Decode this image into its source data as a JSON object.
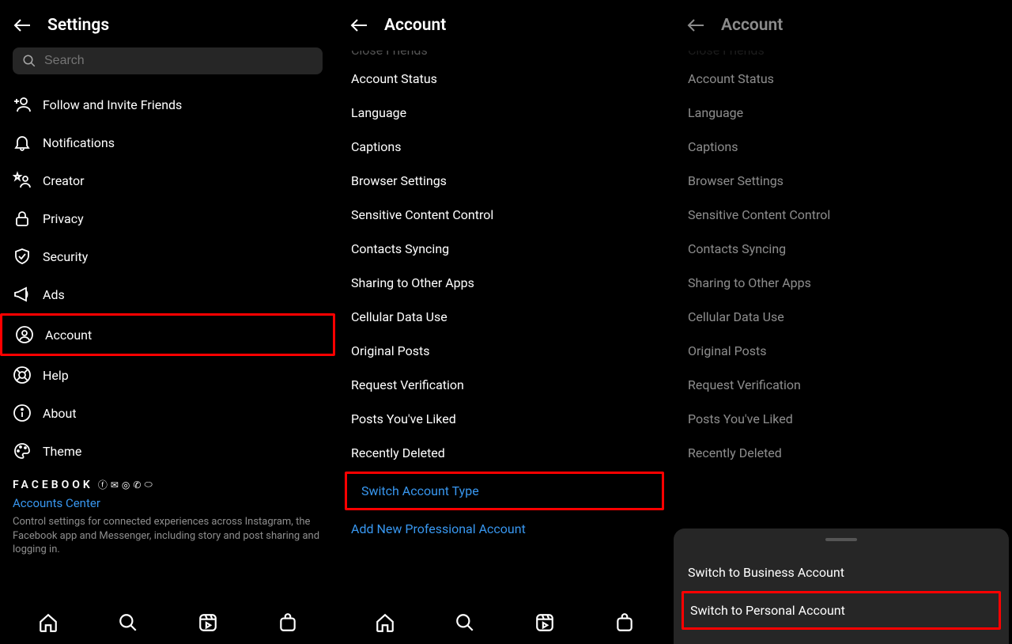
{
  "panel1": {
    "title": "Settings",
    "search_placeholder": "Search",
    "items": [
      {
        "label": "Follow and Invite Friends"
      },
      {
        "label": "Notifications"
      },
      {
        "label": "Creator"
      },
      {
        "label": "Privacy"
      },
      {
        "label": "Security"
      },
      {
        "label": "Ads"
      },
      {
        "label": "Account"
      },
      {
        "label": "Help"
      },
      {
        "label": "About"
      },
      {
        "label": "Theme"
      }
    ],
    "facebook_label": "FACEBOOK",
    "accounts_center": "Accounts Center",
    "meta_description": "Control settings for connected experiences across Instagram, the Facebook app and Messenger, including story and post sharing and logging in."
  },
  "panel2": {
    "title": "Account",
    "cut_item": "Close Friends",
    "items": [
      "Account Status",
      "Language",
      "Captions",
      "Browser Settings",
      "Sensitive Content Control",
      "Contacts Syncing",
      "Sharing to Other Apps",
      "Cellular Data Use",
      "Original Posts",
      "Request Verification",
      "Posts You've Liked",
      "Recently Deleted"
    ],
    "switch_type": "Switch Account Type",
    "add_pro": "Add New Professional Account"
  },
  "panel3": {
    "title": "Account",
    "cut_item": "Close Friends",
    "items": [
      "Account Status",
      "Language",
      "Captions",
      "Browser Settings",
      "Sensitive Content Control",
      "Contacts Syncing",
      "Sharing to Other Apps",
      "Cellular Data Use",
      "Original Posts",
      "Request Verification",
      "Posts You've Liked",
      "Recently Deleted"
    ],
    "sheet": {
      "business": "Switch to Business Account",
      "personal": "Switch to Personal Account"
    }
  }
}
